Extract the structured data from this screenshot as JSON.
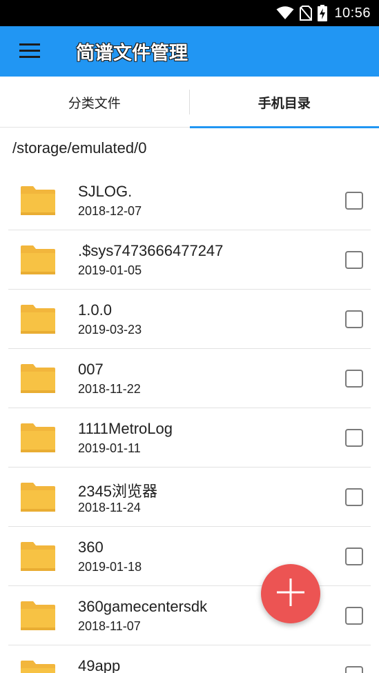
{
  "status_bar": {
    "time": "10:56",
    "icons": [
      "wifi-icon",
      "no-sim-icon",
      "battery-charging-icon"
    ]
  },
  "app_bar": {
    "menu_icon": "hamburger-menu-icon",
    "title": "简谱文件管理",
    "color": "#2196f3"
  },
  "tabs": [
    {
      "label": "分类文件",
      "active": false
    },
    {
      "label": "手机目录",
      "active": true
    }
  ],
  "path": "/storage/emulated/0",
  "files": [
    {
      "name": "SJLOG.",
      "date": "2018-12-07",
      "icon": "folder-icon",
      "checked": false
    },
    {
      "name": ".$sys7473666477247",
      "date": "2019-01-05",
      "icon": "folder-icon",
      "checked": false
    },
    {
      "name": "1.0.0",
      "date": "2019-03-23",
      "icon": "folder-icon",
      "checked": false
    },
    {
      "name": "007",
      "date": "2018-11-22",
      "icon": "folder-icon",
      "checked": false
    },
    {
      "name": "1111MetroLog",
      "date": "2019-01-11",
      "icon": "folder-icon",
      "checked": false
    },
    {
      "name": "2345浏览器",
      "date": "2018-11-24",
      "icon": "folder-icon",
      "checked": false
    },
    {
      "name": "360",
      "date": "2019-01-18",
      "icon": "folder-icon",
      "checked": false
    },
    {
      "name": "360gamecentersdk",
      "date": "2018-11-07",
      "icon": "folder-icon",
      "checked": false
    },
    {
      "name": "49app",
      "date": "",
      "icon": "folder-icon",
      "checked": false
    }
  ],
  "fab": {
    "icon": "plus-icon",
    "color": "#ec5453"
  },
  "colors": {
    "folder": "#f7c244",
    "accent": "#2196f3"
  }
}
